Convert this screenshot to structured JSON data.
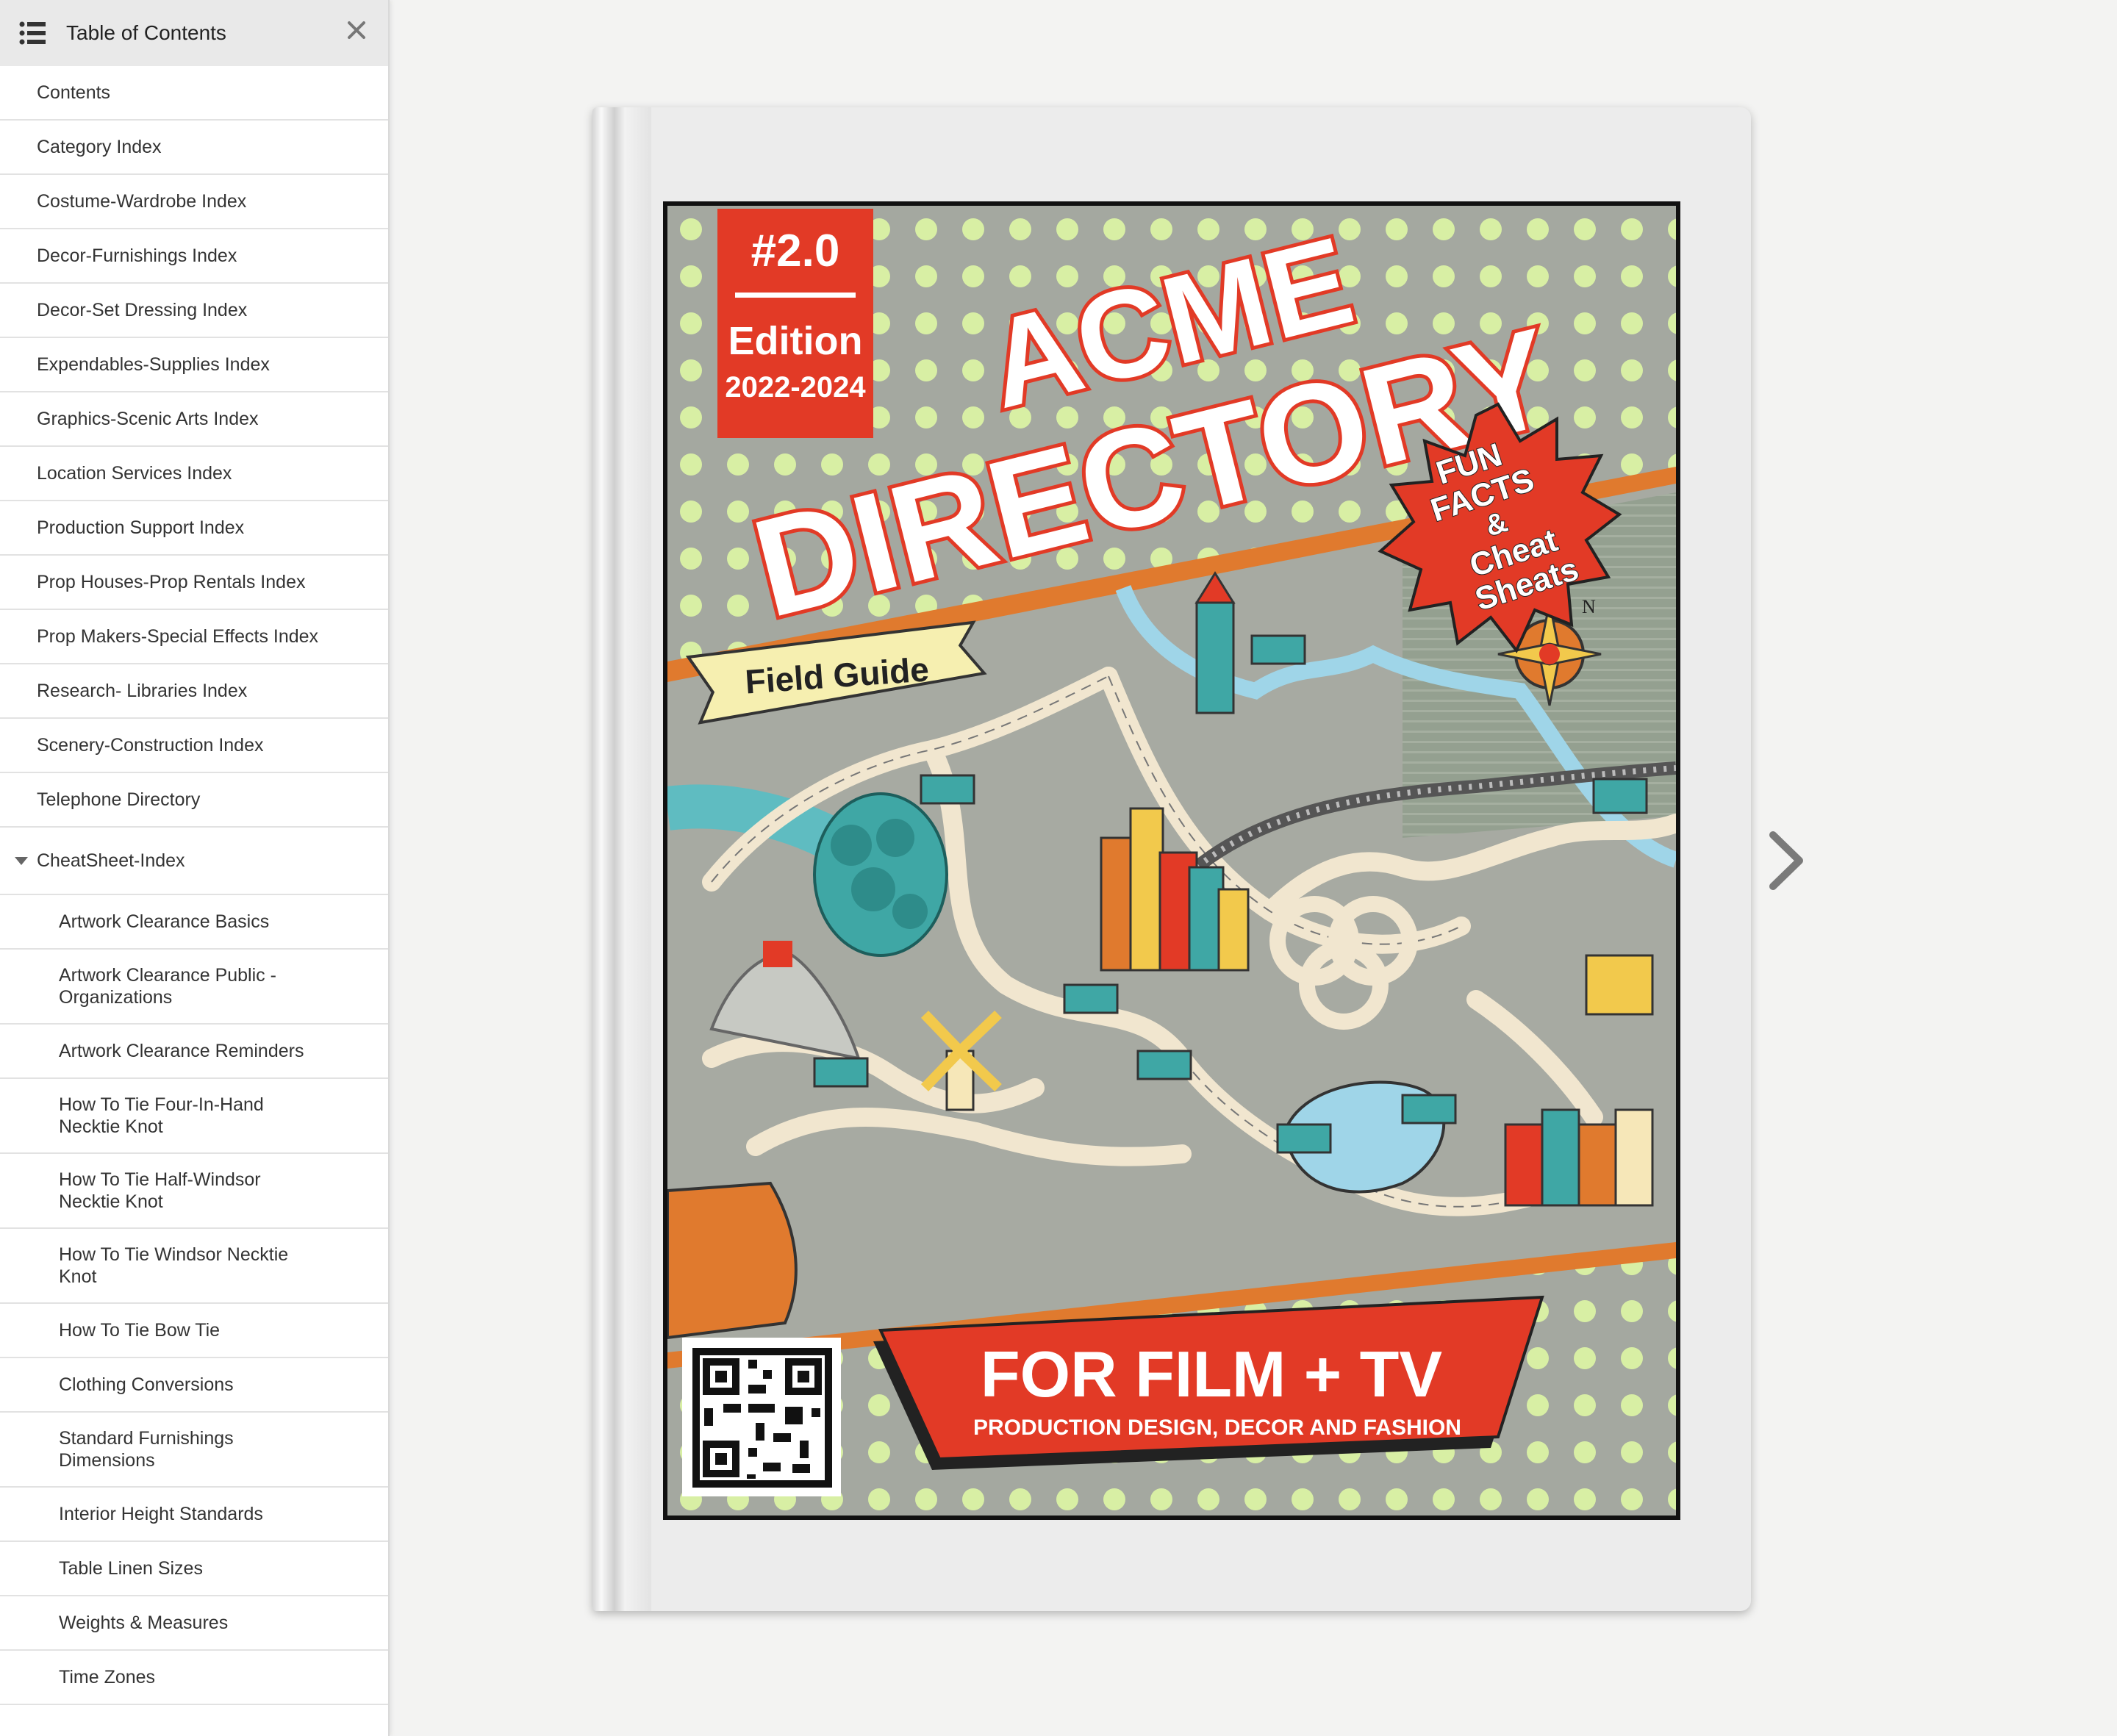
{
  "sidebar": {
    "title": "Table of Contents",
    "items": [
      {
        "label": "Contents"
      },
      {
        "label": "Category Index"
      },
      {
        "label": "Costume-Wardrobe Index"
      },
      {
        "label": "Decor-Furnishings Index"
      },
      {
        "label": "Decor-Set Dressing Index"
      },
      {
        "label": "Expendables-Supplies Index"
      },
      {
        "label": "Graphics-Scenic Arts Index"
      },
      {
        "label": "Location Services Index"
      },
      {
        "label": "Production Support Index"
      },
      {
        "label": "Prop Houses-Prop Rentals Index"
      },
      {
        "label": "Prop Makers-Special Effects Index"
      },
      {
        "label": "Research- Libraries Index"
      },
      {
        "label": "Scenery-Construction Index"
      },
      {
        "label": "Telephone Directory"
      }
    ],
    "group": {
      "label": "CheatSheet-Index",
      "expanded": true,
      "children": [
        {
          "label": "Artwork Clearance Basics"
        },
        {
          "label": "Artwork Clearance Public - Organizations"
        },
        {
          "label": "Artwork Clearance Reminders"
        },
        {
          "label": "How To Tie Four-In-Hand Necktie Knot"
        },
        {
          "label": "How To Tie Half-Windsor Necktie Knot"
        },
        {
          "label": "How To Tie Windsor Necktie Knot"
        },
        {
          "label": "How To Tie Bow Tie"
        },
        {
          "label": "Clothing Conversions"
        },
        {
          "label": "Standard Furnishings Dimensions"
        },
        {
          "label": "Interior Height Standards"
        },
        {
          "label": "Table Linen Sizes"
        },
        {
          "label": "Weights & Measures"
        },
        {
          "label": "Time Zones"
        }
      ]
    }
  },
  "cover": {
    "edition_number": "#2.0",
    "edition_label": "Edition",
    "edition_years": "2022-2024",
    "title_line1": "ACME",
    "title_line2": "DIRECTORY",
    "starburst_lines": [
      "FUN",
      "FACTS",
      "&",
      "Cheat",
      "Sheats"
    ],
    "field_guide": "Field Guide",
    "banner_title": "FOR FILM + TV",
    "banner_subtitle": "PRODUCTION DESIGN, DECOR AND FASHION",
    "compass_letter": "N"
  },
  "colors": {
    "cover_red": "#e23a26",
    "dot_green": "#d8efa4",
    "map_gray": "#a7aaa2",
    "road": "#f1e6cf",
    "water": "#9fd5e8",
    "teal": "#3fa7a5",
    "orange": "#e07a2e"
  },
  "icons": {
    "list": "list-icon",
    "close": "close-icon",
    "next": "chevron-right-icon"
  }
}
